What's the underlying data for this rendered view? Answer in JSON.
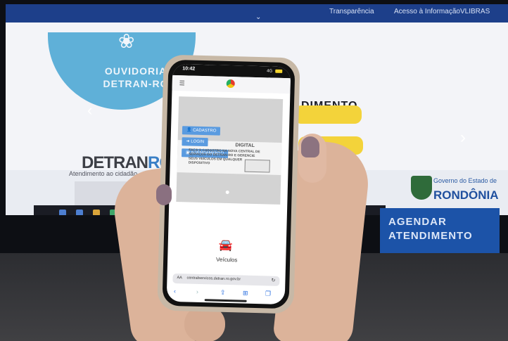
{
  "monitor": {
    "topbar_links": [
      "Transparência",
      "Acesso à Informação",
      "VLIBRAS"
    ],
    "topbar_chevron": "chevron-down-icon",
    "ouvidoria_text": "OUVIDORIA DETRAN-RO",
    "detran_logo_text": "DETRAN",
    "detran_logo_suffix": "RO",
    "heading_fragment": "DIMENTO",
    "gov_label": "Governo do Estado de",
    "state_name": "RONDÔNIA",
    "atendimento_label": "Atendimento ao cidadão",
    "agendar_text": "AGENDAR ATENDIMENTO",
    "accent_blue": "#1d3f8a",
    "accent_yellow": "#f3d33a"
  },
  "phone": {
    "time": "10:42",
    "network": "4G",
    "menu_icon": "hamburger-icon",
    "logo_icon": "detran-logo-icon",
    "buttons": {
      "cadastro": "CADASTRO",
      "login": "LOGIN",
      "agendamento": "AGENDAMENTO"
    },
    "slide": {
      "heading_fragment": "DIGITAL",
      "text": "FAÇA O CADASTRO NA NOVA CENTRAL DE SERVIÇOS DO DETRAN-RO E GERENCIE SEUS VEÍCULOS EM QUALQUER DISPOSITIVO"
    },
    "section_icon": "car-icon",
    "section_label": "Veículos",
    "browser": {
      "text_size_label": "AA",
      "url": "centralservicos.detran.ro.gov.br",
      "reload_icon": "reload-icon",
      "toolbar_icons": [
        "back-icon",
        "forward-icon",
        "share-icon",
        "bookmarks-icon",
        "tabs-icon"
      ]
    },
    "button_color": "#5a9be0"
  }
}
